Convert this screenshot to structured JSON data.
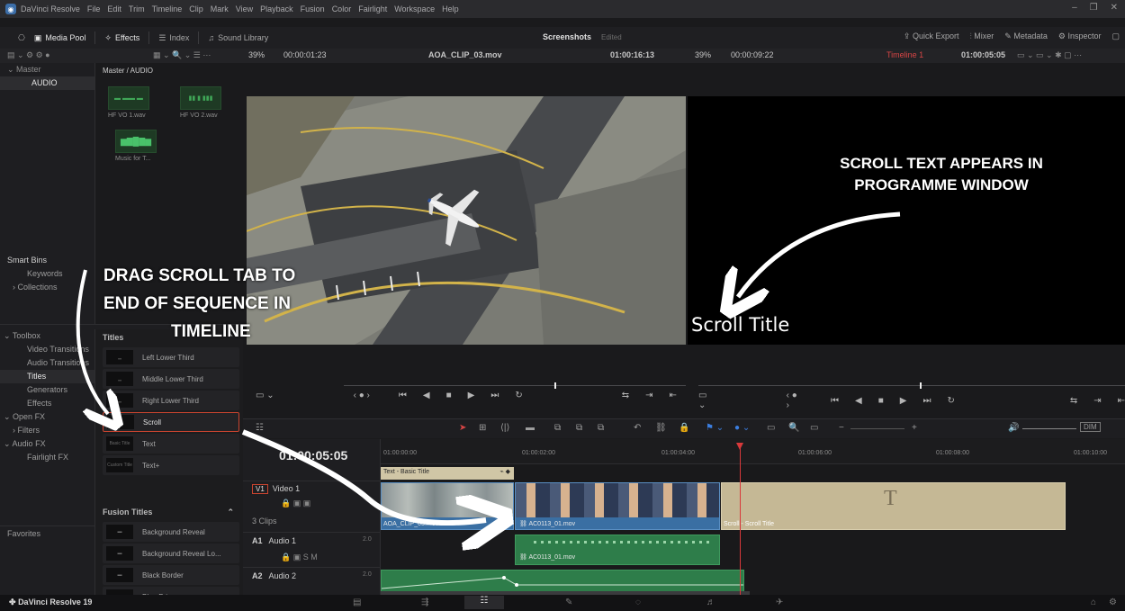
{
  "menubar": {
    "items": [
      "DaVinci Resolve",
      "File",
      "Edit",
      "Trim",
      "Timeline",
      "Clip",
      "Mark",
      "View",
      "Playback",
      "Fusion",
      "Color",
      "Fairlight",
      "Workspace",
      "Help"
    ]
  },
  "toolbar": {
    "media_pool": "Media Pool",
    "effects": "Effects",
    "index": "Index",
    "sound_library": "Sound Library",
    "project_title": "Screenshots",
    "project_status": "Edited",
    "quick_export": "Quick Export",
    "mixer": "Mixer",
    "metadata": "Metadata",
    "inspector": "Inspector"
  },
  "subbar": {
    "source_zoom": "39%",
    "source_tc": "00:00:01:23",
    "source_clip": "AOA_CLIP_03.mov",
    "source_duration": "01:00:16:13",
    "prog_zoom": "39%",
    "prog_tc": "00:00:09:22",
    "timeline_name": "Timeline 1",
    "prog_timecode": "01:00:05:05"
  },
  "sidebar": {
    "master": "Master",
    "audio": "AUDIO",
    "smart_bins": "Smart Bins",
    "keywords": "Keywords",
    "collections": "Collections"
  },
  "bin": {
    "path": "Master / AUDIO",
    "clips": [
      "HF VO 1.wav",
      "HF VO 2.wav",
      "Music for T..."
    ]
  },
  "toolbox": {
    "items": [
      "Toolbox",
      "Video Transitions",
      "Audio Transitions",
      "Titles",
      "Generators",
      "Effects",
      "Open FX",
      "Filters",
      "Audio FX",
      "Fairlight FX",
      "Favorites"
    ]
  },
  "effects_list": {
    "titles_header": "Titles",
    "titles": [
      "Left Lower Third",
      "Middle Lower Third",
      "Right Lower Third",
      "Scroll",
      "Text",
      "Text+"
    ],
    "title_thumbs": [
      "",
      "",
      "",
      "",
      "Basic Title",
      "Custom Title"
    ],
    "fusion_header": "Fusion Titles",
    "fusion": [
      "Background Reveal",
      "Background Reveal Lo...",
      "Black Border",
      "Blue Prism"
    ]
  },
  "viewer": {
    "scroll_title": "Scroll Title"
  },
  "timeline": {
    "timecode": "01:00:05:05",
    "ruler": [
      "01:00:00:00",
      "01:00:02:00",
      "01:00:04:00",
      "01:00:06:00",
      "01:00:08:00",
      "01:00:10:00"
    ],
    "v1_badge": "V1",
    "v1_name": "Video 1",
    "v1_clips": "3 Clips",
    "a1_badge": "A1",
    "a1_name": "Audio 1",
    "a1_level": "2.0",
    "a2_badge": "A2",
    "a2_name": "Audio 2",
    "a2_level": "2.0",
    "dim": "DIM",
    "clip_text": "Text - Basic Title",
    "clip_aoa": "AOA_CLIP_03.mov",
    "clip_ac": "AC0113_01.mov",
    "clip_scroll": "Scroll - Scroll Title",
    "clip_ac_audio": "AC0113_01.mov",
    "scroll_glyph": "T"
  },
  "bottombar": {
    "app_name": "DaVinci Resolve 19"
  },
  "annotations": {
    "top": "SCROLL TEXT APPEARS IN PROGRAMME WINDOW",
    "top_line1": "SCROLL TEXT APPEARS IN",
    "top_line2": "PROGRAMME WINDOW",
    "left_line1": "DRAG SCROLL TAB TO",
    "left_line2": "END OF SEQUENCE IN",
    "left_line3": "TIMELINE"
  },
  "colors": {
    "video_clip": "#3a6fa3",
    "audio_clip": "#2e7d4a",
    "scroll_clip": "#c5b895",
    "text_clip": "#d0c6a6",
    "playhead": "#d8393b",
    "selection": "#c9442f"
  }
}
